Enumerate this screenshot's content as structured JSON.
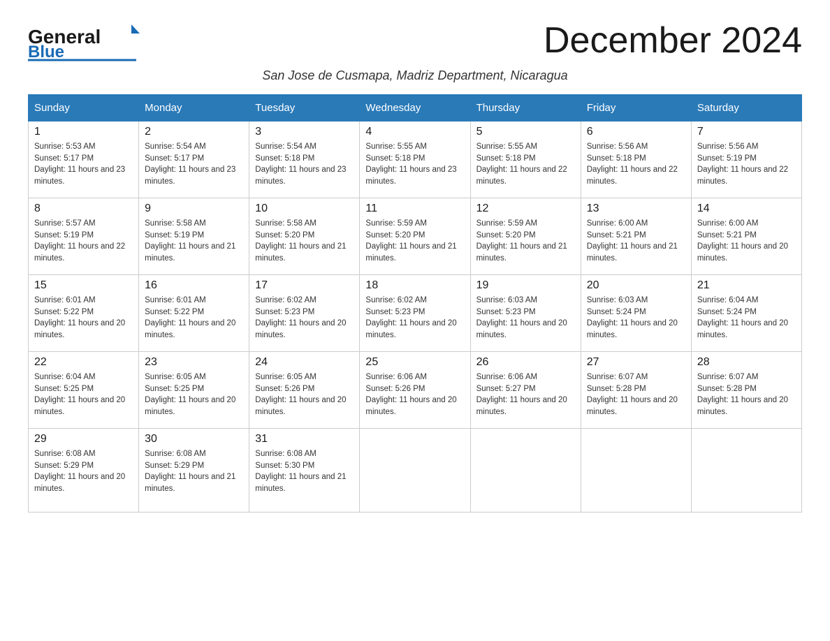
{
  "header": {
    "logo_general": "General",
    "logo_blue": "Blue",
    "month_title": "December 2024",
    "subtitle": "San Jose de Cusmapa, Madriz Department, Nicaragua"
  },
  "days_of_week": [
    "Sunday",
    "Monday",
    "Tuesday",
    "Wednesday",
    "Thursday",
    "Friday",
    "Saturday"
  ],
  "weeks": [
    [
      {
        "day": 1,
        "sunrise": "5:53 AM",
        "sunset": "5:17 PM",
        "daylight": "11 hours and 23 minutes."
      },
      {
        "day": 2,
        "sunrise": "5:54 AM",
        "sunset": "5:17 PM",
        "daylight": "11 hours and 23 minutes."
      },
      {
        "day": 3,
        "sunrise": "5:54 AM",
        "sunset": "5:18 PM",
        "daylight": "11 hours and 23 minutes."
      },
      {
        "day": 4,
        "sunrise": "5:55 AM",
        "sunset": "5:18 PM",
        "daylight": "11 hours and 23 minutes."
      },
      {
        "day": 5,
        "sunrise": "5:55 AM",
        "sunset": "5:18 PM",
        "daylight": "11 hours and 22 minutes."
      },
      {
        "day": 6,
        "sunrise": "5:56 AM",
        "sunset": "5:18 PM",
        "daylight": "11 hours and 22 minutes."
      },
      {
        "day": 7,
        "sunrise": "5:56 AM",
        "sunset": "5:19 PM",
        "daylight": "11 hours and 22 minutes."
      }
    ],
    [
      {
        "day": 8,
        "sunrise": "5:57 AM",
        "sunset": "5:19 PM",
        "daylight": "11 hours and 22 minutes."
      },
      {
        "day": 9,
        "sunrise": "5:58 AM",
        "sunset": "5:19 PM",
        "daylight": "11 hours and 21 minutes."
      },
      {
        "day": 10,
        "sunrise": "5:58 AM",
        "sunset": "5:20 PM",
        "daylight": "11 hours and 21 minutes."
      },
      {
        "day": 11,
        "sunrise": "5:59 AM",
        "sunset": "5:20 PM",
        "daylight": "11 hours and 21 minutes."
      },
      {
        "day": 12,
        "sunrise": "5:59 AM",
        "sunset": "5:20 PM",
        "daylight": "11 hours and 21 minutes."
      },
      {
        "day": 13,
        "sunrise": "6:00 AM",
        "sunset": "5:21 PM",
        "daylight": "11 hours and 21 minutes."
      },
      {
        "day": 14,
        "sunrise": "6:00 AM",
        "sunset": "5:21 PM",
        "daylight": "11 hours and 20 minutes."
      }
    ],
    [
      {
        "day": 15,
        "sunrise": "6:01 AM",
        "sunset": "5:22 PM",
        "daylight": "11 hours and 20 minutes."
      },
      {
        "day": 16,
        "sunrise": "6:01 AM",
        "sunset": "5:22 PM",
        "daylight": "11 hours and 20 minutes."
      },
      {
        "day": 17,
        "sunrise": "6:02 AM",
        "sunset": "5:23 PM",
        "daylight": "11 hours and 20 minutes."
      },
      {
        "day": 18,
        "sunrise": "6:02 AM",
        "sunset": "5:23 PM",
        "daylight": "11 hours and 20 minutes."
      },
      {
        "day": 19,
        "sunrise": "6:03 AM",
        "sunset": "5:23 PM",
        "daylight": "11 hours and 20 minutes."
      },
      {
        "day": 20,
        "sunrise": "6:03 AM",
        "sunset": "5:24 PM",
        "daylight": "11 hours and 20 minutes."
      },
      {
        "day": 21,
        "sunrise": "6:04 AM",
        "sunset": "5:24 PM",
        "daylight": "11 hours and 20 minutes."
      }
    ],
    [
      {
        "day": 22,
        "sunrise": "6:04 AM",
        "sunset": "5:25 PM",
        "daylight": "11 hours and 20 minutes."
      },
      {
        "day": 23,
        "sunrise": "6:05 AM",
        "sunset": "5:25 PM",
        "daylight": "11 hours and 20 minutes."
      },
      {
        "day": 24,
        "sunrise": "6:05 AM",
        "sunset": "5:26 PM",
        "daylight": "11 hours and 20 minutes."
      },
      {
        "day": 25,
        "sunrise": "6:06 AM",
        "sunset": "5:26 PM",
        "daylight": "11 hours and 20 minutes."
      },
      {
        "day": 26,
        "sunrise": "6:06 AM",
        "sunset": "5:27 PM",
        "daylight": "11 hours and 20 minutes."
      },
      {
        "day": 27,
        "sunrise": "6:07 AM",
        "sunset": "5:28 PM",
        "daylight": "11 hours and 20 minutes."
      },
      {
        "day": 28,
        "sunrise": "6:07 AM",
        "sunset": "5:28 PM",
        "daylight": "11 hours and 20 minutes."
      }
    ],
    [
      {
        "day": 29,
        "sunrise": "6:08 AM",
        "sunset": "5:29 PM",
        "daylight": "11 hours and 20 minutes."
      },
      {
        "day": 30,
        "sunrise": "6:08 AM",
        "sunset": "5:29 PM",
        "daylight": "11 hours and 21 minutes."
      },
      {
        "day": 31,
        "sunrise": "6:08 AM",
        "sunset": "5:30 PM",
        "daylight": "11 hours and 21 minutes."
      },
      null,
      null,
      null,
      null
    ]
  ],
  "colors": {
    "header_bg": "#2a7ab8",
    "header_text": "#ffffff",
    "border": "#cccccc",
    "title_color": "#1a1a1a",
    "logo_blue": "#1a6bb5"
  }
}
